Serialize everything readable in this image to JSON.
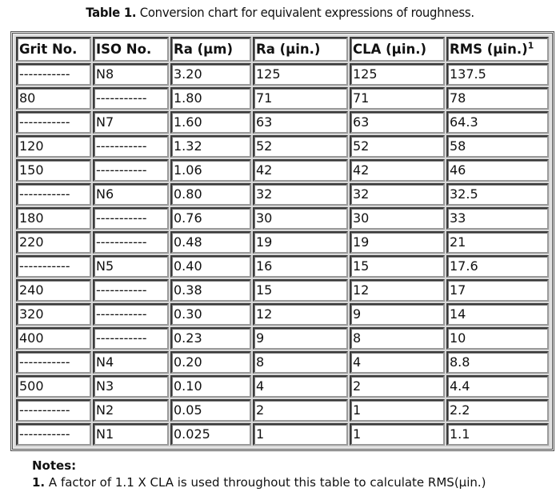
{
  "caption": {
    "label": "Table 1.",
    "text": " Conversion chart for equivalent expressions of roughness."
  },
  "table": {
    "headers": [
      "Grit No.",
      "ISO No.",
      "Ra (µm)",
      "Ra (µin.)",
      "CLA (µin.)",
      "RMS (µin.)"
    ],
    "rms_footnote_marker": "1",
    "rows": [
      [
        "-----------",
        "N8",
        "3.20",
        "125",
        "125",
        "137.5"
      ],
      [
        "80",
        "-----------",
        "1.80",
        "71",
        "71",
        "78"
      ],
      [
        "-----------",
        "N7",
        "1.60",
        "63",
        "63",
        "64.3"
      ],
      [
        "120",
        "-----------",
        "1.32",
        "52",
        "52",
        "58"
      ],
      [
        "150",
        "-----------",
        "1.06",
        "42",
        "42",
        "46"
      ],
      [
        "-----------",
        "N6",
        "0.80",
        "32",
        "32",
        "32.5"
      ],
      [
        "180",
        "-----------",
        "0.76",
        "30",
        "30",
        "33"
      ],
      [
        "220",
        "-----------",
        "0.48",
        "19",
        "19",
        "21"
      ],
      [
        "-----------",
        "N5",
        "0.40",
        "16",
        "15",
        "17.6"
      ],
      [
        "240",
        "-----------",
        "0.38",
        "15",
        "12",
        "17"
      ],
      [
        "320",
        "-----------",
        "0.30",
        "12",
        "9",
        "14"
      ],
      [
        "400",
        "-----------",
        "0.23",
        "9",
        "8",
        "10"
      ],
      [
        "-----------",
        "N4",
        "0.20",
        "8",
        "4",
        "8.8"
      ],
      [
        "500",
        "N3",
        "0.10",
        "4",
        "2",
        "4.4"
      ],
      [
        "-----------",
        "N2",
        "0.05",
        "2",
        "1",
        "2.2"
      ],
      [
        "-----------",
        "N1",
        "0.025",
        "1",
        "1",
        "1.1"
      ]
    ]
  },
  "notes": {
    "title": "Notes:",
    "items": [
      {
        "number": "1.",
        "text": " A factor of 1.1 X CLA is used throughout this table to calculate RMS(µin.)"
      }
    ]
  }
}
